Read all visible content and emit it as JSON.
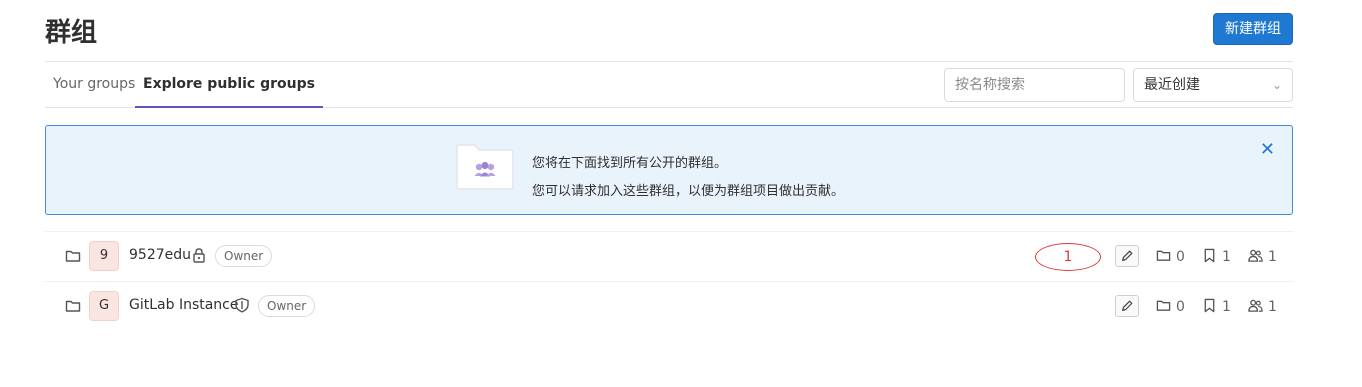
{
  "header": {
    "title": "群组",
    "new_group_label": "新建群组"
  },
  "tabs": [
    {
      "label": "Your groups",
      "active": false
    },
    {
      "label": "Explore public groups",
      "active": true
    }
  ],
  "filters": {
    "search_placeholder": "按名称搜索",
    "sort_selected": "最近创建"
  },
  "banner": {
    "line1": "您将在下面找到所有公开的群组。",
    "line2": "您可以请求加入这些群组，以便为群组项目做出贡献。"
  },
  "groups": [
    {
      "avatar_letter": "9",
      "name": "9527edu",
      "visibility_icon": "lock-icon",
      "role": "Owner",
      "subgroups": "0",
      "projects": "1",
      "members": "1"
    },
    {
      "avatar_letter": "G",
      "name": "GitLab Instance",
      "visibility_icon": "shield-icon",
      "role": "Owner",
      "subgroups": "0",
      "projects": "1",
      "members": "1"
    }
  ],
  "annotation": {
    "label": "1"
  },
  "colors": {
    "primary": "#1f78d1",
    "tab_active": "#6b4fbb",
    "banner_bg": "#e9f3fc",
    "annotation": "#e03a3a"
  }
}
